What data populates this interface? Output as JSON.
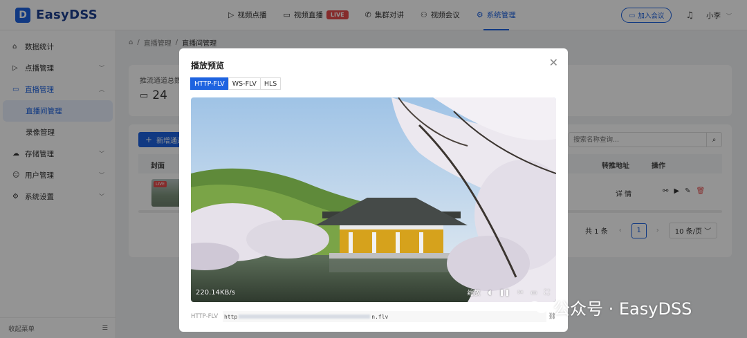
{
  "header": {
    "logo_mark": "D",
    "logo_text": "EasyDSS",
    "nav": [
      {
        "icon": "▷",
        "label": "视频点播"
      },
      {
        "icon": "▭",
        "label": "视频直播",
        "badge": "LIVE"
      },
      {
        "icon": "✆",
        "label": "集群对讲"
      },
      {
        "icon": "⚇",
        "label": "视频会议"
      },
      {
        "icon": "⚙",
        "label": "系统管理"
      }
    ],
    "join_label": "加入会议",
    "user_name": "小李"
  },
  "sidebar": {
    "items": [
      {
        "icon": "⌂",
        "label": "数据统计"
      },
      {
        "icon": "▷",
        "label": "点播管理"
      },
      {
        "icon": "▭",
        "label": "直播管理"
      },
      {
        "label": "直播间管理"
      },
      {
        "label": "录像管理"
      },
      {
        "icon": "☁",
        "label": "存储管理"
      },
      {
        "icon": "☺",
        "label": "用户管理"
      },
      {
        "icon": "⚙",
        "label": "系统设置"
      }
    ],
    "footer_label": "收起菜单"
  },
  "breadcrumb": [
    "直播管理",
    "直播间管理"
  ],
  "stats": {
    "label": "推流通道总数",
    "value": "24"
  },
  "toolbar": {
    "add_label": "新增通道",
    "search_placeholder": "搜索名称查询..."
  },
  "table": {
    "columns": [
      "封面",
      "转推地址",
      "操作"
    ],
    "row": {
      "badge": "LIVE",
      "detail": "详 情"
    }
  },
  "pagination": {
    "total": "共 1 条",
    "page": "1",
    "page_size": "10 条/页"
  },
  "modal": {
    "title": "播放预览",
    "tabs": [
      "HTTP-FLV",
      "WS-FLV",
      "HLS"
    ],
    "bitrate": "220.14KB/s",
    "zoom_label": "缩放",
    "url_label": "HTTP-FLV",
    "url_start": "http",
    "url_end": "n.flv"
  },
  "watermark": "公众号 · EasyDSS",
  "colors": {
    "accent": "#1e63e0",
    "live": "#e64a4a"
  }
}
